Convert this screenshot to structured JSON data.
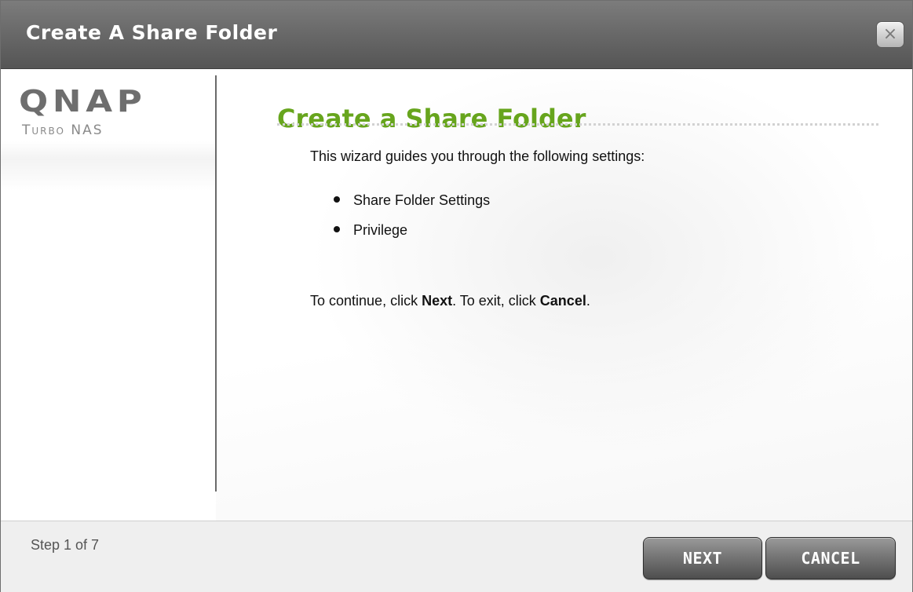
{
  "window": {
    "title": "Create A Share Folder",
    "close_glyph": "×"
  },
  "brand": {
    "logo": "QNAP",
    "subtitle": "Turbo NAS"
  },
  "content": {
    "heading": "Create a Share Folder",
    "intro": "This wizard guides you through the following settings:",
    "bullets": [
      "Share Folder Settings",
      "Privilege"
    ],
    "continue": {
      "prefix": "To continue, click ",
      "next_word": "Next",
      "middle": ". To exit, click ",
      "cancel_word": "Cancel",
      "suffix": "."
    }
  },
  "footer": {
    "step": "Step 1 of 7",
    "next_label": "NEXT",
    "cancel_label": "CANCEL"
  },
  "colors": {
    "heading_green": "#67a51d",
    "titlebar": "#6a6a6a",
    "button_dark": "#4e4e4e"
  },
  "icons": {
    "close": "close-icon"
  }
}
